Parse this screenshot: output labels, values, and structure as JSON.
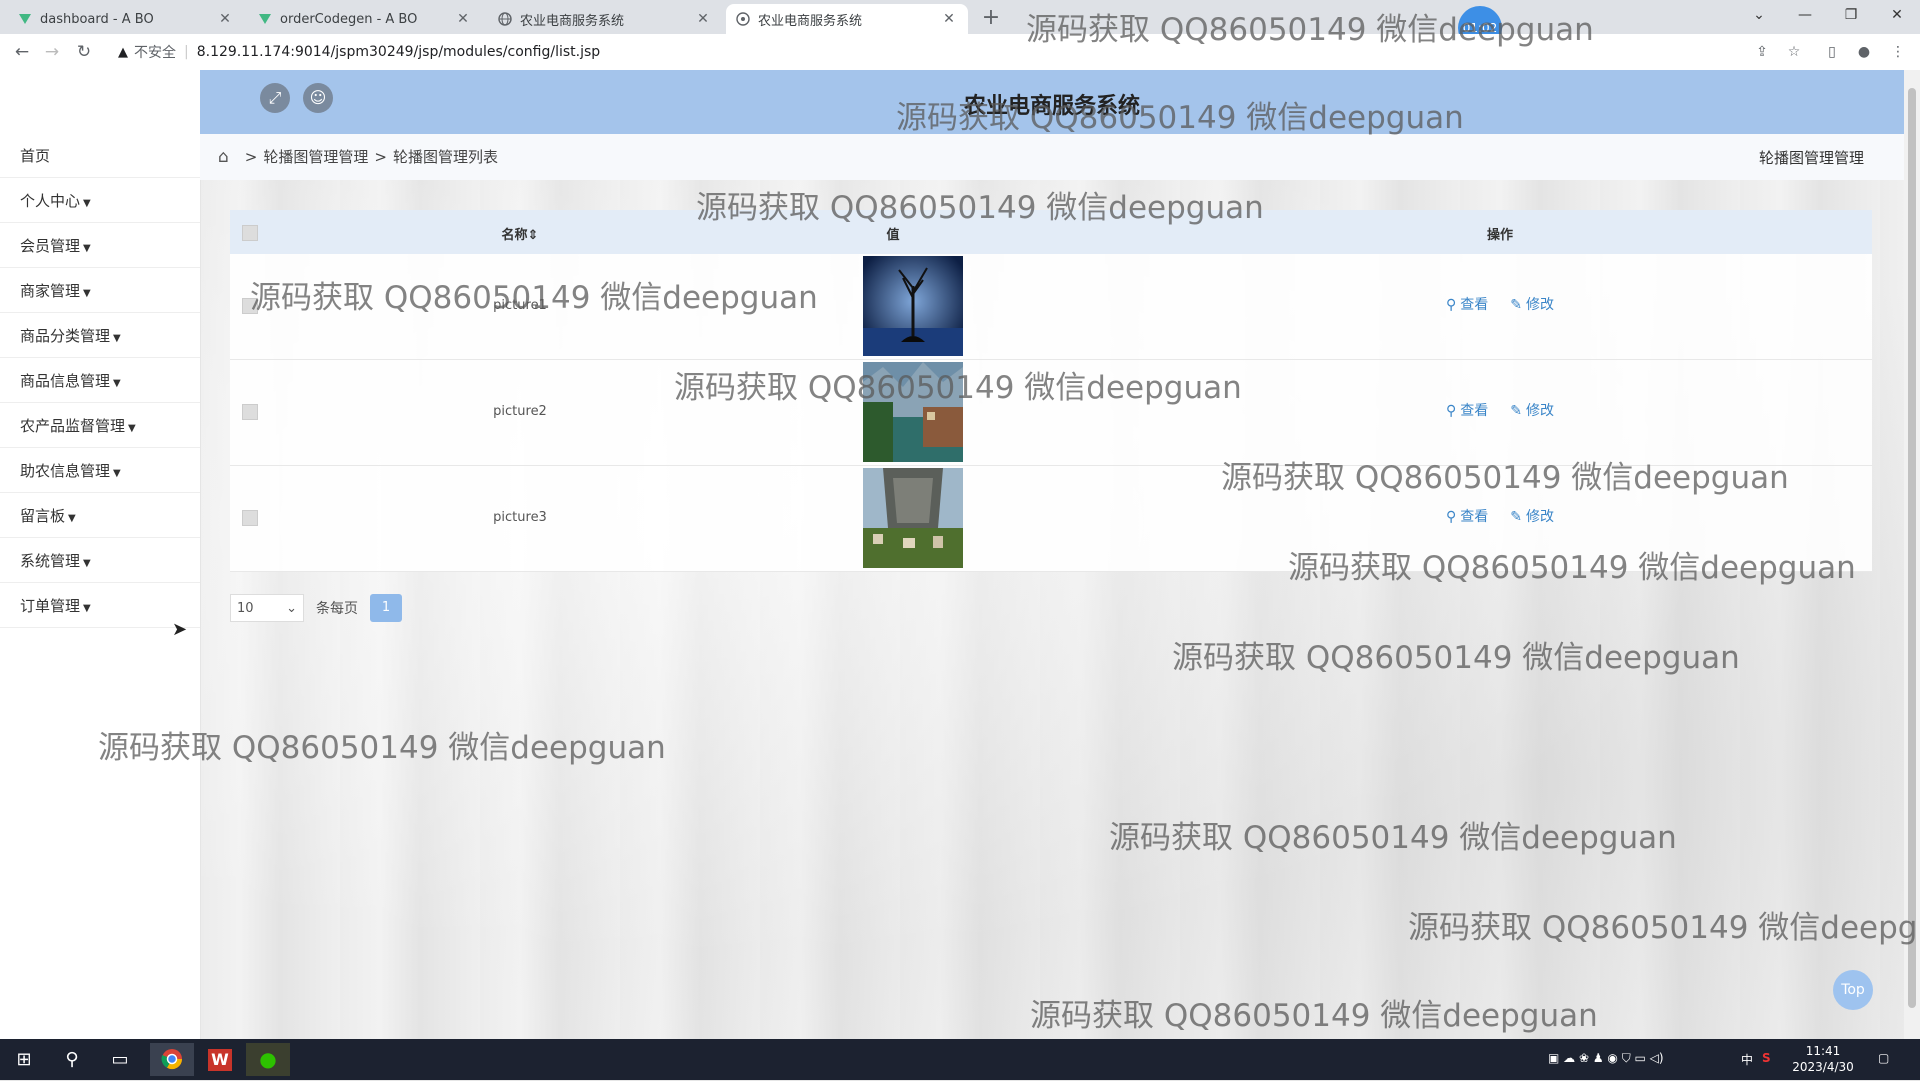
{
  "browser": {
    "tabs": [
      {
        "title": "dashboard - A BO"
      },
      {
        "title": "orderCodegen - A BO"
      },
      {
        "title": "农业电商服务系统"
      },
      {
        "title": "农业电商服务系统"
      }
    ],
    "insecure_label": "不安全",
    "url": "8.129.11.174:9014/jspm30249/jsp/modules/config/list.jsp",
    "badge": "01:02"
  },
  "sidebar": {
    "items": [
      {
        "label": "首页",
        "has_caret": false
      },
      {
        "label": "个人中心",
        "has_caret": true
      },
      {
        "label": "会员管理",
        "has_caret": true
      },
      {
        "label": "商家管理",
        "has_caret": true
      },
      {
        "label": "商品分类管理",
        "has_caret": true
      },
      {
        "label": "商品信息管理",
        "has_caret": true
      },
      {
        "label": "农产品监督管理",
        "has_caret": true
      },
      {
        "label": "助农信息管理",
        "has_caret": true
      },
      {
        "label": "留言板",
        "has_caret": true
      },
      {
        "label": "系统管理",
        "has_caret": true
      },
      {
        "label": "订单管理",
        "has_caret": true
      }
    ]
  },
  "header": {
    "title": "农业电商服务系统"
  },
  "breadcrumb": {
    "level1": "轮播图管理管理",
    "level2": "轮播图管理列表",
    "right": "轮播图管理管理"
  },
  "table": {
    "headers": {
      "name": "名称",
      "value": "值",
      "ops": "操作"
    },
    "rows": [
      {
        "name": "picture1"
      },
      {
        "name": "picture2"
      },
      {
        "name": "picture3"
      }
    ],
    "view_label": "查看",
    "edit_label": "修改"
  },
  "pager": {
    "page_size": "10",
    "per_page_label": "条每页",
    "current_page": "1"
  },
  "top_button": "Top",
  "watermark": "源码获取 QQ86050149 微信deepguan",
  "taskbar": {
    "time": "11:41",
    "date": "2023/4/30",
    "ime": "中"
  },
  "colors": {
    "header": "#a4c4eb",
    "link": "#3a85c8",
    "pager_active": "#8fb9ea"
  }
}
